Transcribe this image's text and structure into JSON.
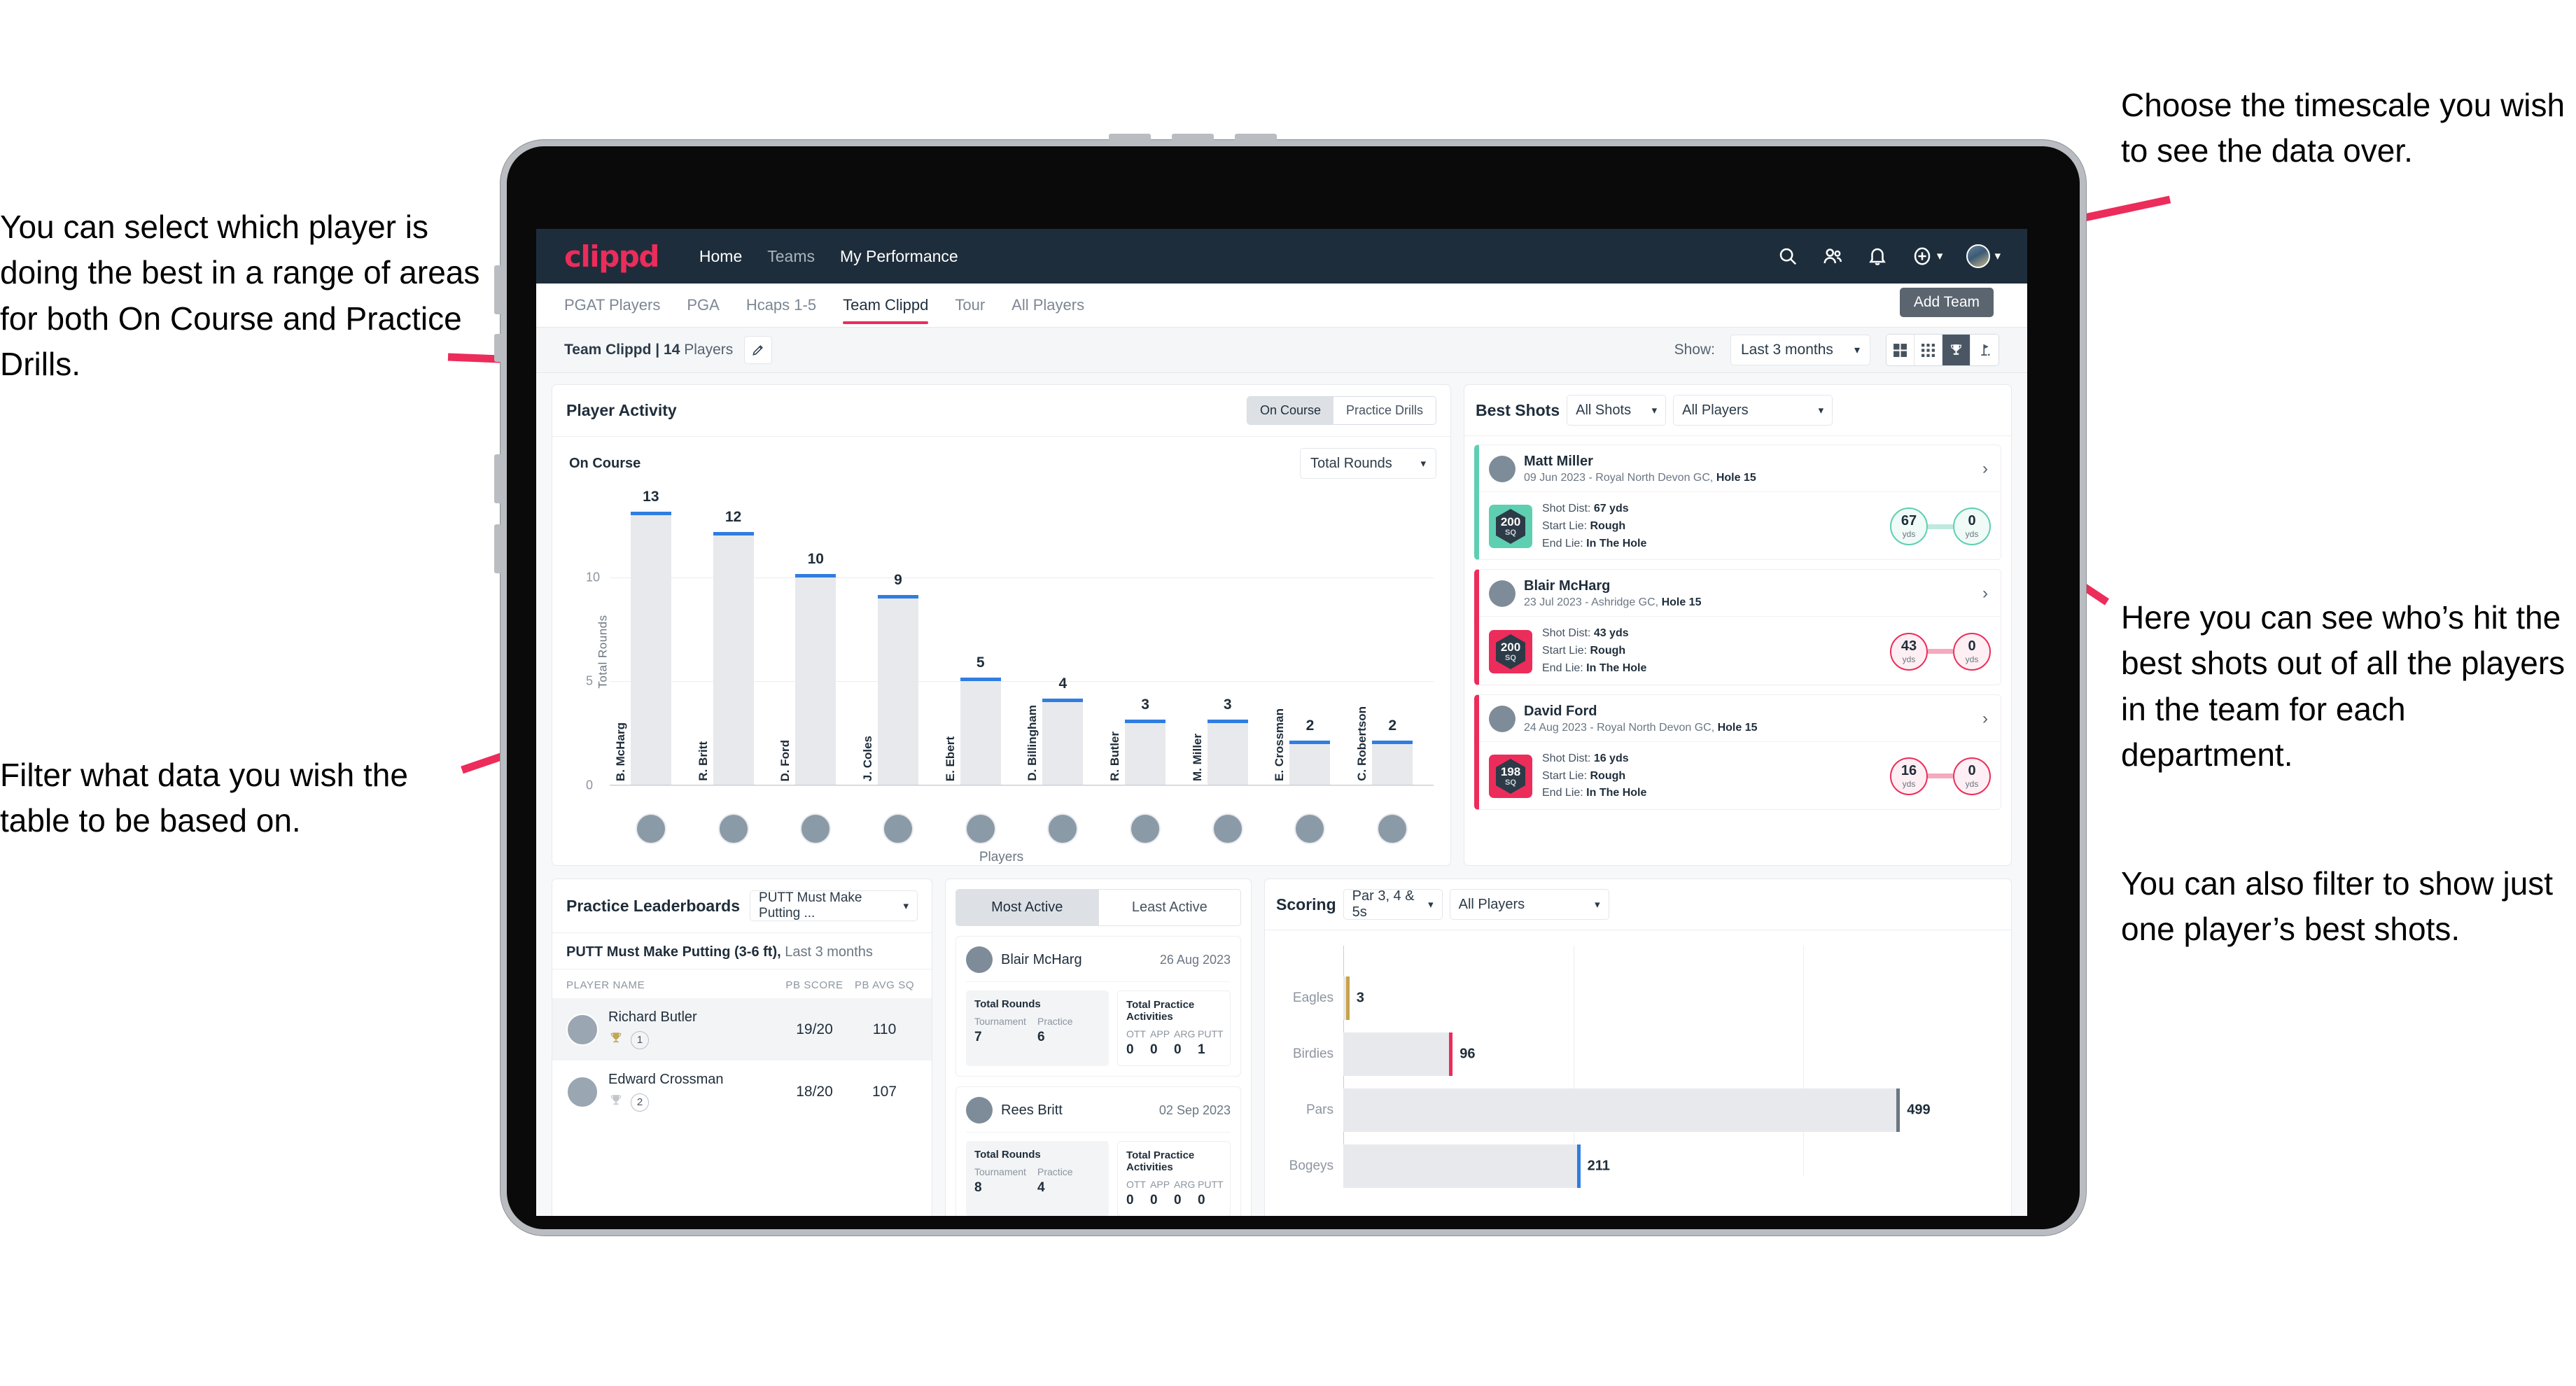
{
  "annotations": {
    "left_top": "You can select which player is doing the best in a range of areas for both On Course and Practice Drills.",
    "left_bottom": "Filter what data you wish the table to be based on.",
    "right_top": "Choose the timescale you wish to see the data over.",
    "right_middle": "Here you can see who’s hit the best shots out of all the players in the team for each department.",
    "right_bottom": "You can also filter to show just one player’s best shots."
  },
  "topnav": {
    "brand": "clippd",
    "links": [
      {
        "label": "Home",
        "active": true
      },
      {
        "label": "Teams",
        "active": false
      },
      {
        "label": "My Performance",
        "active": true
      }
    ],
    "icons": [
      "search-icon",
      "people-icon",
      "bell-icon",
      "plus-circle-icon",
      "avatar"
    ]
  },
  "tabs": {
    "items": [
      {
        "label": "PGAT Players",
        "active": false
      },
      {
        "label": "PGA",
        "active": false
      },
      {
        "label": "Hcaps 1-5",
        "active": false
      },
      {
        "label": "Team Clippd",
        "active": true
      },
      {
        "label": "Tour",
        "active": false
      },
      {
        "label": "All Players",
        "active": false
      }
    ],
    "tooltip": "Add Team"
  },
  "subheader": {
    "team_name": "Team Clippd",
    "separator": "|",
    "player_count": "14",
    "players_word": "Players",
    "show_label": "Show:",
    "timescale": "Last 3 months",
    "view_buttons": [
      "grid-large-icon",
      "grid-small-icon",
      "trophy-icon",
      "flag-icon"
    ],
    "active_view": 2
  },
  "player_activity": {
    "title": "Player Activity",
    "segments": [
      {
        "label": "On Course",
        "active": true
      },
      {
        "label": "Practice Drills",
        "active": false
      }
    ],
    "sub_label": "On Course",
    "metric_select": "Total Rounds"
  },
  "chart_data": [
    {
      "type": "bar",
      "title": "Player Activity – On Course",
      "xlabel": "Players",
      "ylabel": "Total Rounds",
      "categories": [
        "B. McHarg",
        "R. Britt",
        "D. Ford",
        "J. Coles",
        "E. Ebert",
        "D. Billingham",
        "R. Butler",
        "M. Miller",
        "E. Crossman",
        "C. Robertson"
      ],
      "values": [
        13,
        12,
        10,
        9,
        5,
        4,
        3,
        3,
        2,
        2
      ],
      "ylim": [
        0,
        14
      ],
      "yticks": [
        0,
        5,
        10
      ],
      "grid": true,
      "bar_color": "#e7e9ed",
      "cap_color": "#2f7de1",
      "legend": "none"
    },
    {
      "type": "bar",
      "orientation": "horizontal",
      "title": "Scoring",
      "categories": [
        "Eagles",
        "Birdies",
        "Pars",
        "Bogeys"
      ],
      "values": [
        3,
        96,
        499,
        211
      ],
      "cap_colors": [
        "#c7a24b",
        "#ec2c5a",
        "#6b7682",
        "#2f7de1"
      ],
      "xlim": [
        0,
        560
      ],
      "grid": true,
      "legend": "none"
    }
  ],
  "best_shots": {
    "title": "Best Shots",
    "shot_filter": "All Shots",
    "player_filter": "All Players",
    "items": [
      {
        "player": "Matt Miller",
        "meta_date": "09 Jun 2023",
        "meta_sep": " - ",
        "meta_course": "Royal North Devon GC,",
        "meta_hole": "Hole 15",
        "sq": "200",
        "sq_unit": "SQ",
        "accent": "#5ecfb1",
        "shot_dist_label": "Shot Dist:",
        "shot_dist": "67 yds",
        "start_lie_label": "Start Lie:",
        "start_lie": "Rough",
        "end_lie_label": "End Lie:",
        "end_lie": "In The Hole",
        "from_val": "67",
        "from_unit": "yds",
        "to_val": "0",
        "to_unit": "yds"
      },
      {
        "player": "Blair McHarg",
        "meta_date": "23 Jul 2023",
        "meta_sep": " - ",
        "meta_course": "Ashridge GC,",
        "meta_hole": "Hole 15",
        "sq": "200",
        "sq_unit": "SQ",
        "accent": "#ec2c5a",
        "shot_dist_label": "Shot Dist:",
        "shot_dist": "43 yds",
        "start_lie_label": "Start Lie:",
        "start_lie": "Rough",
        "end_lie_label": "End Lie:",
        "end_lie": "In The Hole",
        "from_val": "43",
        "from_unit": "yds",
        "to_val": "0",
        "to_unit": "yds"
      },
      {
        "player": "David Ford",
        "meta_date": "24 Aug 2023",
        "meta_sep": " - ",
        "meta_course": "Royal North Devon GC,",
        "meta_hole": "Hole 15",
        "sq": "198",
        "sq_unit": "SQ",
        "accent": "#ec2c5a",
        "shot_dist_label": "Shot Dist:",
        "shot_dist": "16 yds",
        "start_lie_label": "Start Lie:",
        "start_lie": "Rough",
        "end_lie_label": "End Lie:",
        "end_lie": "In The Hole",
        "from_val": "16",
        "from_unit": "yds",
        "to_val": "0",
        "to_unit": "yds"
      }
    ]
  },
  "practice_leaderboards": {
    "title": "Practice Leaderboards",
    "drill_select": "PUTT Must Make Putting ...",
    "subtitle_bold": "PUTT Must Make Putting (3-6 ft),",
    "subtitle_dim": "Last 3 months",
    "columns": [
      "PLAYER NAME",
      "PB SCORE",
      "PB AVG SQ"
    ],
    "rows": [
      {
        "name": "Richard Butler",
        "rank": "1",
        "medal": "gold",
        "pb_score": "19/20",
        "pb_avg_sq": "110"
      },
      {
        "name": "Edward Crossman",
        "rank": "2",
        "medal": "silver",
        "pb_score": "18/20",
        "pb_avg_sq": "107"
      }
    ]
  },
  "activity": {
    "tabs": [
      {
        "label": "Most Active",
        "active": true
      },
      {
        "label": "Least Active",
        "active": false
      }
    ],
    "cards": [
      {
        "name": "Blair McHarg",
        "date": "26 Aug 2023",
        "rounds_title": "Total Rounds",
        "rounds_keys": [
          "Tournament",
          "Practice"
        ],
        "rounds_vals": [
          "7",
          "6"
        ],
        "practice_title": "Total Practice Activities",
        "practice_keys": [
          "OTT",
          "APP",
          "ARG",
          "PUTT"
        ],
        "practice_vals": [
          "0",
          "0",
          "0",
          "1"
        ]
      },
      {
        "name": "Rees Britt",
        "date": "02 Sep 2023",
        "rounds_title": "Total Rounds",
        "rounds_keys": [
          "Tournament",
          "Practice"
        ],
        "rounds_vals": [
          "8",
          "4"
        ],
        "practice_title": "Total Practice Activities",
        "practice_keys": [
          "OTT",
          "APP",
          "ARG",
          "PUTT"
        ],
        "practice_vals": [
          "0",
          "0",
          "0",
          "0"
        ]
      }
    ]
  },
  "scoring": {
    "title": "Scoring",
    "par_filter": "Par 3, 4 & 5s",
    "player_filter": "All Players"
  }
}
